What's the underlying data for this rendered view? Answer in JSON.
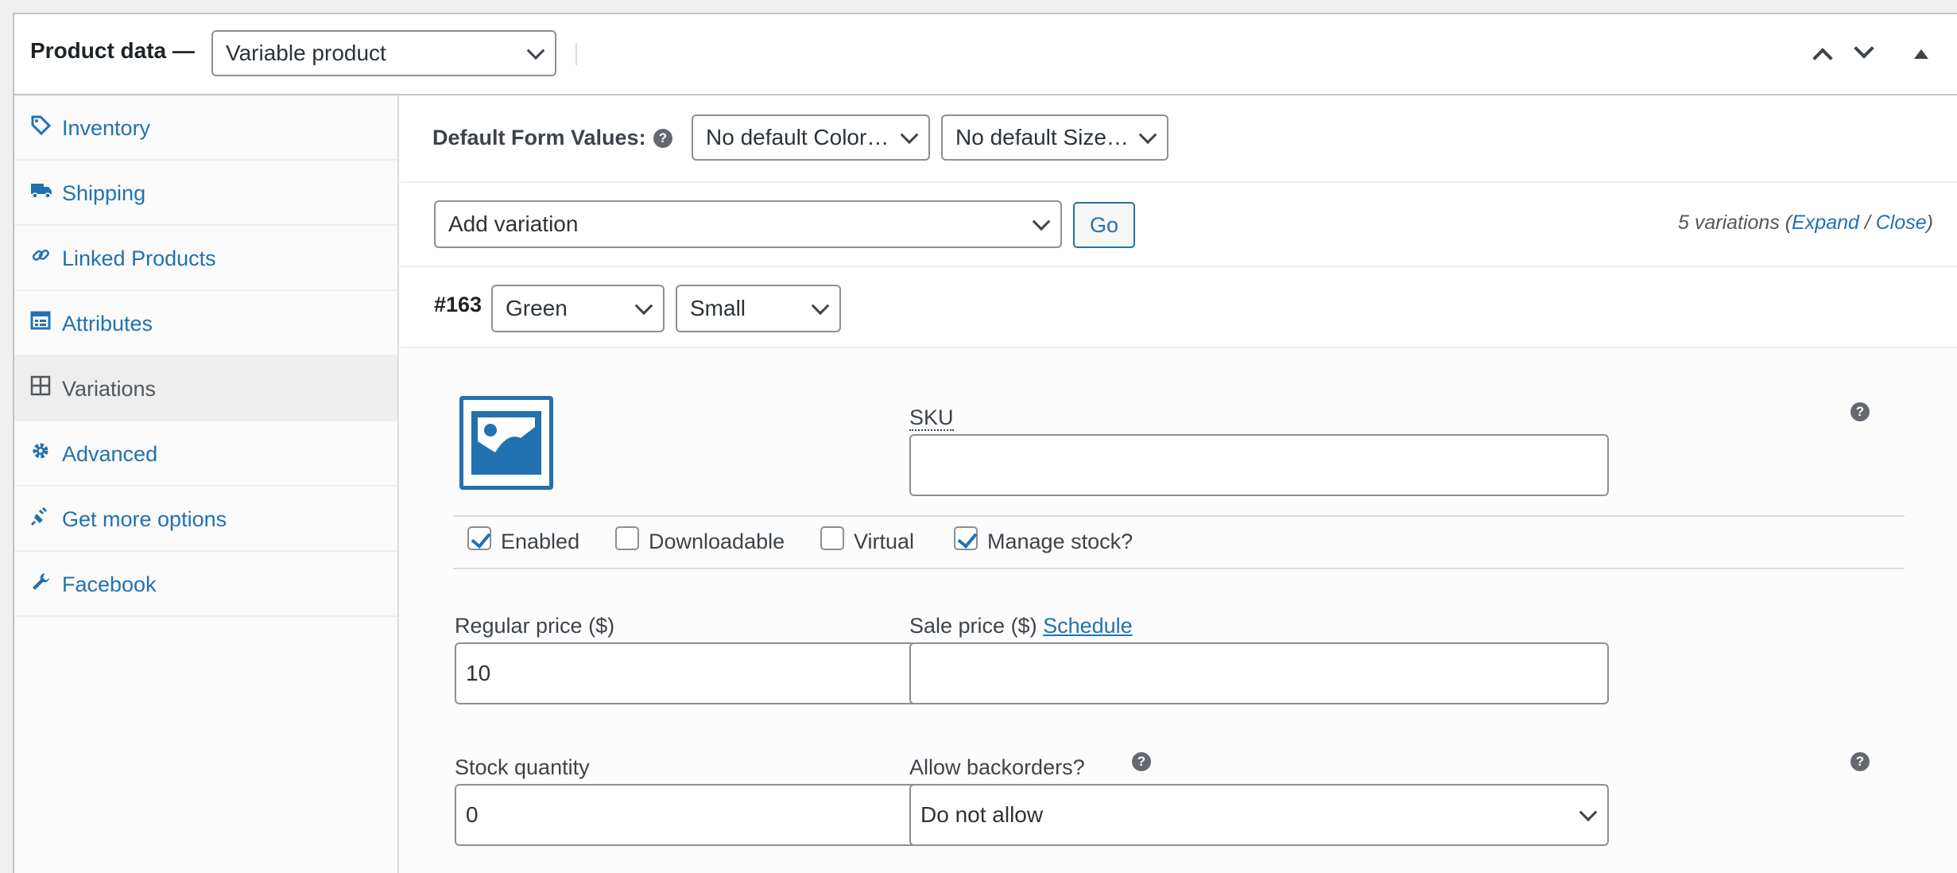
{
  "header": {
    "title": "Product data —",
    "product_type": "Variable product"
  },
  "sidebar": {
    "items": [
      {
        "label": "Inventory",
        "icon": "tag-icon"
      },
      {
        "label": "Shipping",
        "icon": "truck-icon"
      },
      {
        "label": "Linked Products",
        "icon": "link-icon"
      },
      {
        "label": "Attributes",
        "icon": "list-icon"
      },
      {
        "label": "Variations",
        "icon": "grid-icon",
        "active": true
      },
      {
        "label": "Advanced",
        "icon": "gear-icon"
      },
      {
        "label": "Get more options",
        "icon": "plugin-icon"
      },
      {
        "label": "Facebook",
        "icon": "wrench-icon"
      }
    ]
  },
  "defaults": {
    "label": "Default Form Values:",
    "color_select": "No default Color…",
    "size_select": "No default Size…"
  },
  "actions": {
    "bulk_select": "Add variation",
    "go_label": "Go",
    "count_text": "5 variations (",
    "expand": "Expand",
    "sep": " / ",
    "close": "Close",
    "count_end": ")"
  },
  "variation": {
    "id": "#163",
    "color": "Green",
    "size": "Small",
    "sku_label": "SKU",
    "sku_value": "",
    "enabled_label": "Enabled",
    "downloadable_label": "Downloadable",
    "virtual_label": "Virtual",
    "manage_stock_label": "Manage stock?",
    "enabled": true,
    "downloadable": false,
    "virtual": false,
    "manage_stock": true,
    "regular_price_label": "Regular price ($)",
    "regular_price": "10",
    "sale_price_label": "Sale price ($)",
    "schedule_link": "Schedule",
    "sale_price": "",
    "stock_qty_label": "Stock quantity",
    "stock_qty": "0",
    "backorders_label": "Allow backorders?",
    "backorders": "Do not allow"
  },
  "colors": {
    "accent": "#2271b1"
  }
}
